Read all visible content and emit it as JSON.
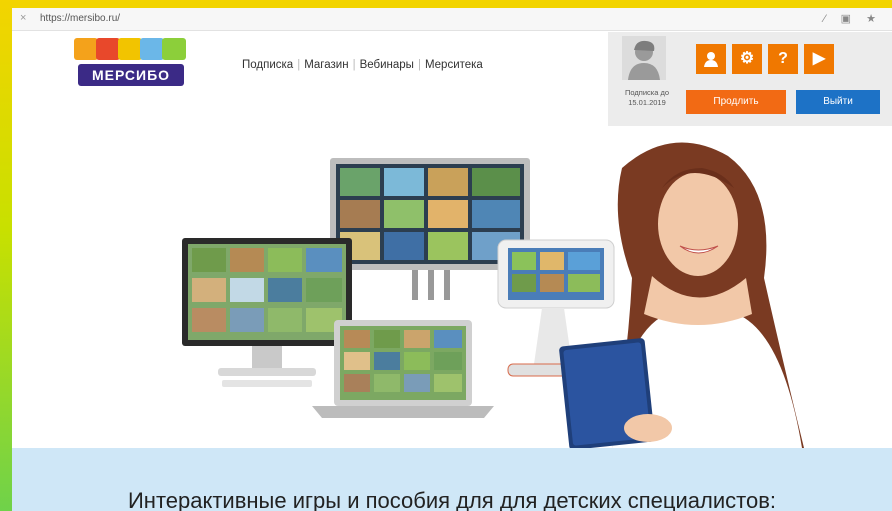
{
  "browser": {
    "close_glyph": "×",
    "url": "https://mersibo.ru/",
    "tools": "⁄ ▣ ★"
  },
  "logo": {
    "text": "МЕРСИБО",
    "block_colors": [
      "#f4a21b",
      "#e8482b",
      "#f2c400",
      "#6bb7e8",
      "#8ccf3a"
    ]
  },
  "nav": {
    "items": [
      "Подписка",
      "Магазин",
      "Вебинары",
      "Мерситека"
    ]
  },
  "user_panel": {
    "subscription_label": "Подписка до",
    "subscription_date": "15.01.2019",
    "icons": [
      {
        "name": "user-icon",
        "glyph": "👤"
      },
      {
        "name": "settings-icon",
        "glyph": "⚙"
      },
      {
        "name": "help-icon",
        "glyph": "?"
      },
      {
        "name": "play-icon",
        "glyph": "▶"
      }
    ],
    "renew_label": "Продлить",
    "exit_label": "Выйти",
    "accent_orange": "#f07800",
    "accent_blue": "#1d72c6"
  },
  "banner": {
    "tagline": "Интерактивные игры и пособия для для детских специалистов:"
  }
}
